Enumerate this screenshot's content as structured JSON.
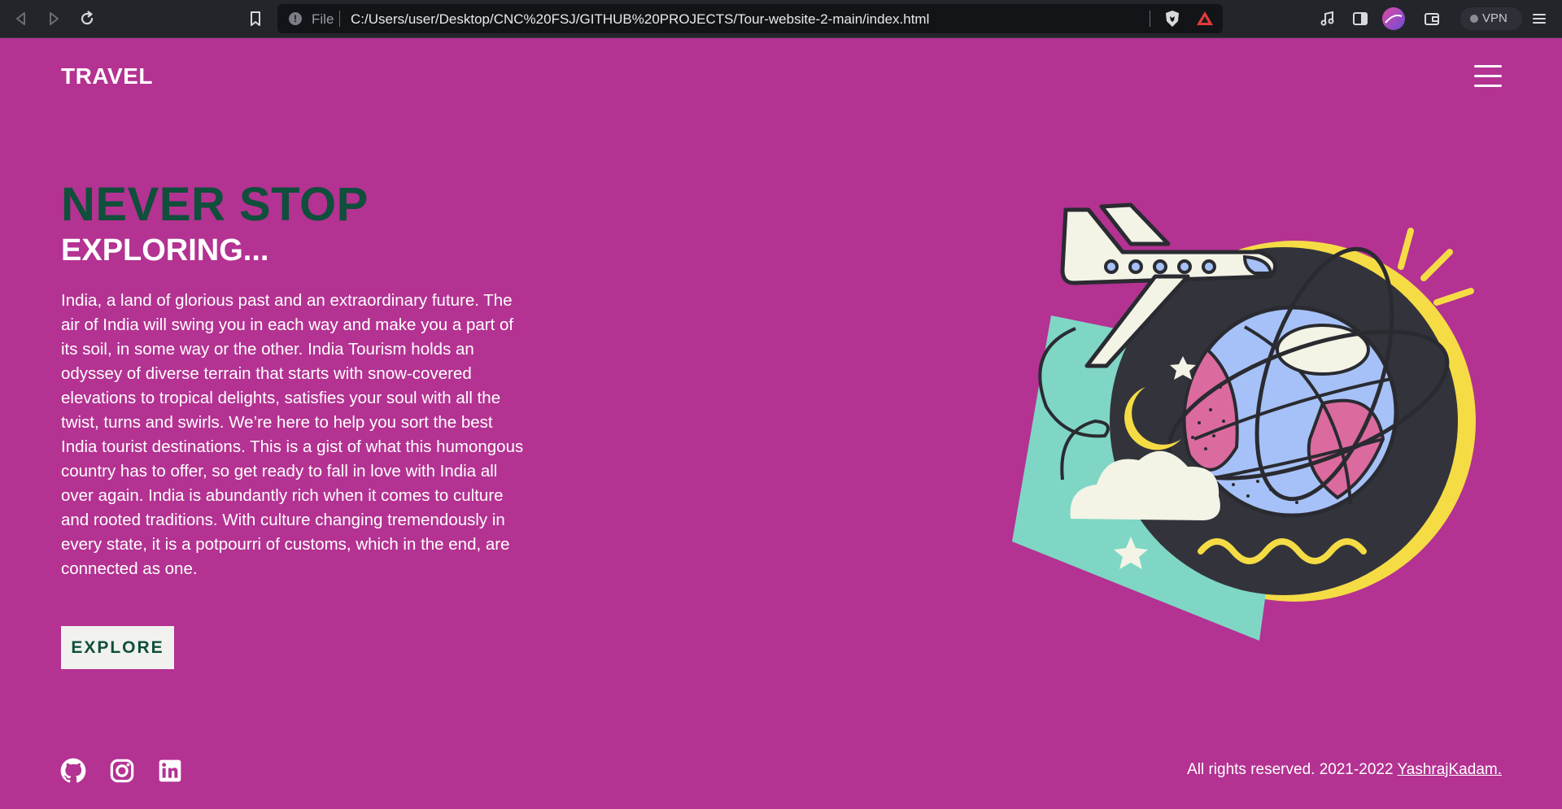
{
  "browser": {
    "scheme": "File",
    "url": "C:/Users/user/Desktop/CNC%20FSJ/GITHUB%20PROJECTS/Tour-website-2-main/index.html",
    "vpn_label": "VPN"
  },
  "header": {
    "logo": "TRAVEL"
  },
  "hero": {
    "title": "NEVER STOP",
    "subtitle": "EXPLORING...",
    "description": "India, a land of glorious past and an extraordinary future. The air of India will swing you in each way and make you a part of its soil, in some way or the other. India Tourism holds an odyssey of diverse terrain that starts with snow-covered elevations to tropical delights, satisfies your soul with all the twist, turns and swirls. We’re here to help you sort the best India tourist destinations. This is a gist of what this humongous country has to offer, so get ready to fall in love with India all over again. India is abundantly rich when it comes to culture and rooted traditions. With culture changing tremendously in every state, it is a potpourri of customs, which in the end, are connected as one.",
    "cta_label": "EXPLORE"
  },
  "footer": {
    "social_icons": [
      "github-icon",
      "instagram-icon",
      "linkedin-icon"
    ],
    "copyright": "All rights reserved. 2021-2022",
    "author_link": "YashrajKadam."
  },
  "colors": {
    "background": "#b43292",
    "title_green": "#0f4f3b",
    "button_bg": "#f1f1ee",
    "illustration_yellow": "#f5dc45",
    "illustration_teal": "#7fd6c4",
    "illustration_dark": "#33343b",
    "illustration_blue": "#a6c1f7",
    "illustration_pink": "#db6a9f"
  }
}
